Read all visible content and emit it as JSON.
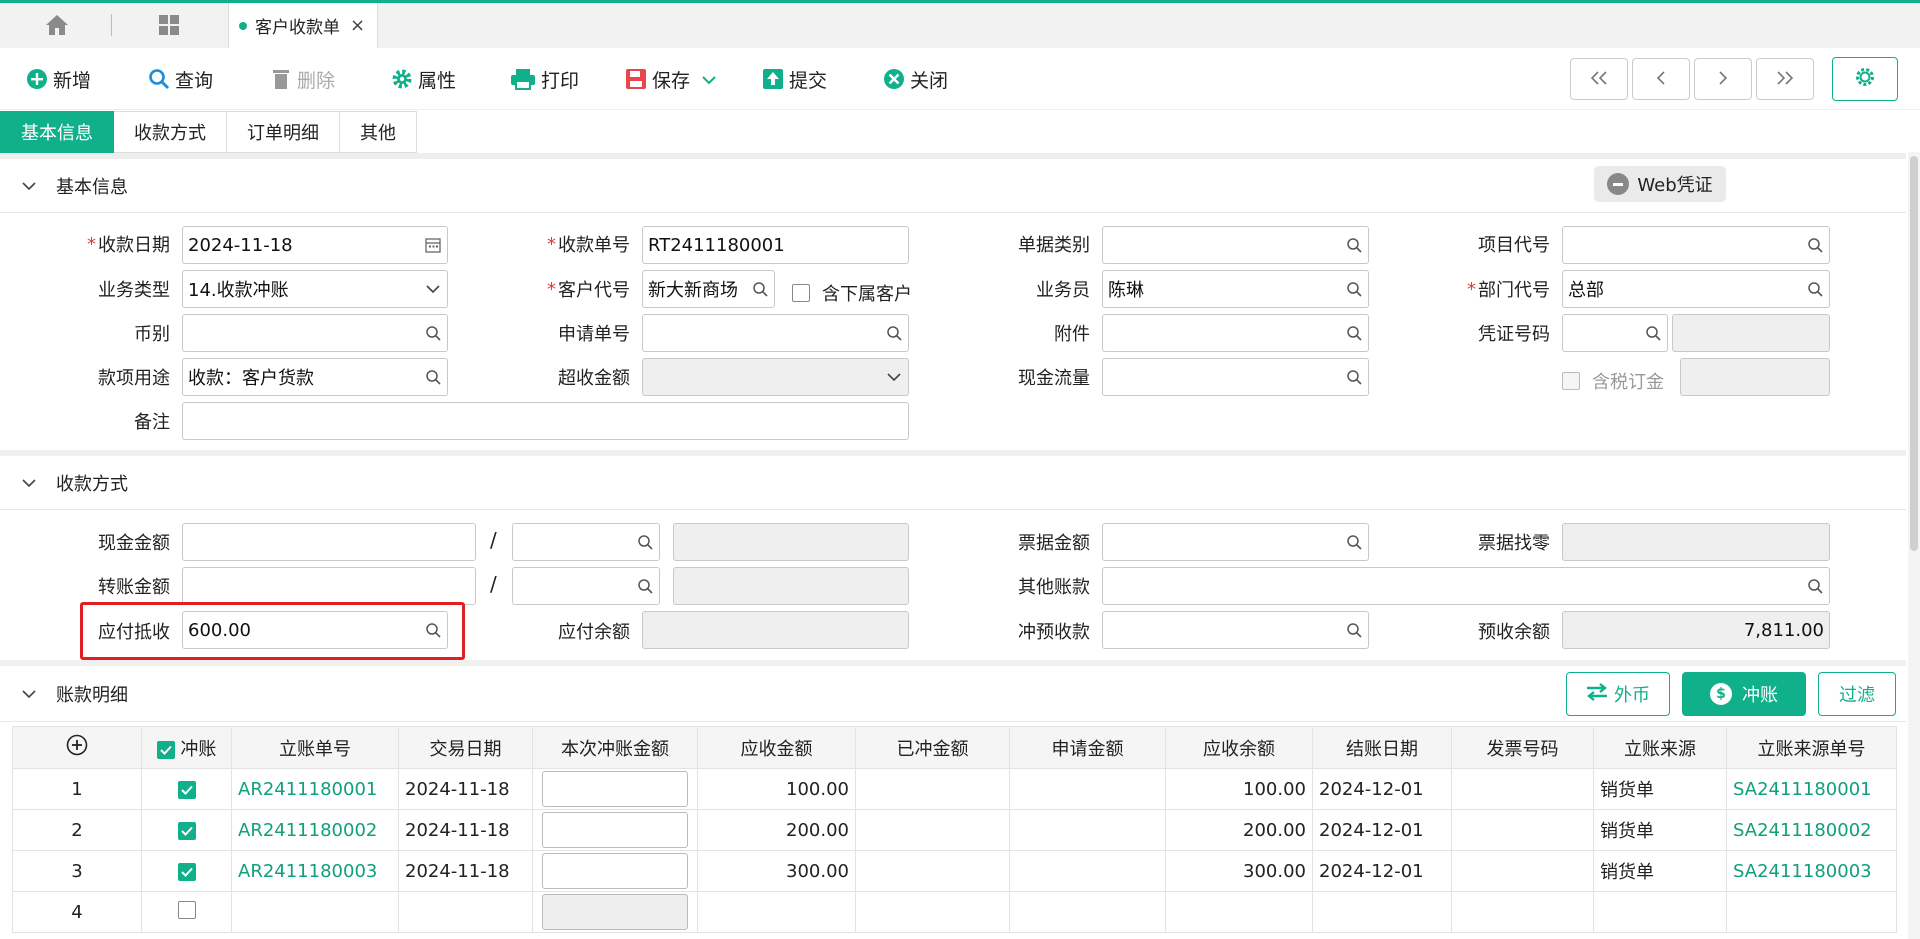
{
  "top_tab": {
    "label": "客户收款单"
  },
  "toolbar": {
    "add": "新增",
    "query": "查询",
    "delete": "删除",
    "properties": "属性",
    "print": "打印",
    "save": "保存",
    "submit": "提交",
    "close": "关闭"
  },
  "section_tabs": [
    "基本信息",
    "收款方式",
    "订单明细",
    "其他"
  ],
  "basic": {
    "title": "基本信息",
    "web_voucher": "Web凭证",
    "receipt_date_label": "收款日期",
    "receipt_date": "2024-11-18",
    "receipt_no_label": "收款单号",
    "receipt_no": "RT2411180001",
    "doc_type_label": "单据类别",
    "project_code_label": "项目代号",
    "biz_type_label": "业务类型",
    "biz_type": "14.收款冲账",
    "customer_code_label": "客户代号",
    "customer_code": "新大新商场",
    "include_sub_label": "含下属客户",
    "salesman_label": "业务员",
    "salesman": "陈琳",
    "dept_code_label": "部门代号",
    "dept_code": "总部",
    "currency_label": "币别",
    "apply_no_label": "申请单号",
    "attachment_label": "附件",
    "voucher_no_label": "凭证号码",
    "purpose_label": "款项用途",
    "purpose": "收款：客户货款",
    "over_amount_label": "超收金额",
    "cash_flow_label": "现金流量",
    "tax_deposit_label": "含税订金",
    "remark_label": "备注"
  },
  "payment": {
    "title": "收款方式",
    "cash_label": "现金金额",
    "transfer_label": "转账金额",
    "bill_label": "票据金额",
    "bill_change_label": "票据找零",
    "other_label": "其他账款",
    "payable_offset_label": "应付抵收",
    "payable_offset": "600.00",
    "payable_balance_label": "应付余额",
    "prepay_offset_label": "冲预收款",
    "prepay_balance_label": "预收余额",
    "prepay_balance": "7,811.00"
  },
  "detail": {
    "title": "账款明细",
    "btn_fx": "外币",
    "btn_offset": "冲账",
    "btn_filter": "过滤",
    "columns": [
      "冲账",
      "立账单号",
      "交易日期",
      "本次冲账金额",
      "应收金额",
      "已冲金额",
      "申请金额",
      "应收余额",
      "结账日期",
      "发票号码",
      "立账来源",
      "立账来源单号"
    ],
    "rows": [
      {
        "idx": "1",
        "checked": true,
        "ar_no": "AR2411180001",
        "trade_date": "2024-11-18",
        "receivable": "100.00",
        "balance": "100.00",
        "close_date": "2024-12-01",
        "source": "销货单",
        "source_no": "SA2411180001"
      },
      {
        "idx": "2",
        "checked": true,
        "ar_no": "AR2411180002",
        "trade_date": "2024-11-18",
        "receivable": "200.00",
        "balance": "200.00",
        "close_date": "2024-12-01",
        "source": "销货单",
        "source_no": "SA2411180002"
      },
      {
        "idx": "3",
        "checked": true,
        "ar_no": "AR2411180003",
        "trade_date": "2024-11-18",
        "receivable": "300.00",
        "balance": "300.00",
        "close_date": "2024-12-01",
        "source": "销货单",
        "source_no": "SA2411180003"
      },
      {
        "idx": "4",
        "checked": false,
        "ar_no": "",
        "trade_date": "",
        "receivable": "",
        "balance": "",
        "close_date": "",
        "source": "",
        "source_no": ""
      }
    ]
  }
}
